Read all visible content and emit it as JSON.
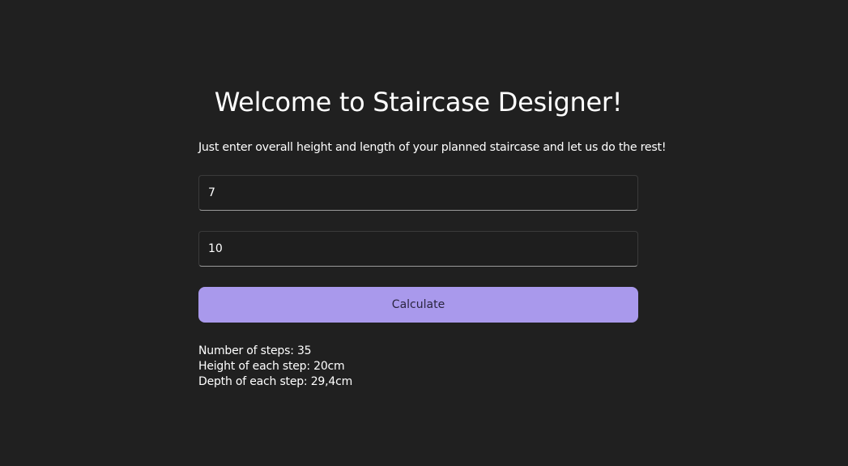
{
  "page": {
    "title": "Welcome to Staircase Designer!",
    "subtitle": "Just enter overall height and length of your planned staircase and let us do the rest!"
  },
  "form": {
    "height_value": "7",
    "length_value": "10",
    "calculate_label": "Calculate"
  },
  "results": {
    "steps": "Number of steps: 35",
    "step_height": "Height of each step: 20cm",
    "step_depth": "Depth of each step: 29,4cm"
  },
  "colors": {
    "background": "#202020",
    "accent": "#a999ec",
    "text": "#ffffff"
  }
}
